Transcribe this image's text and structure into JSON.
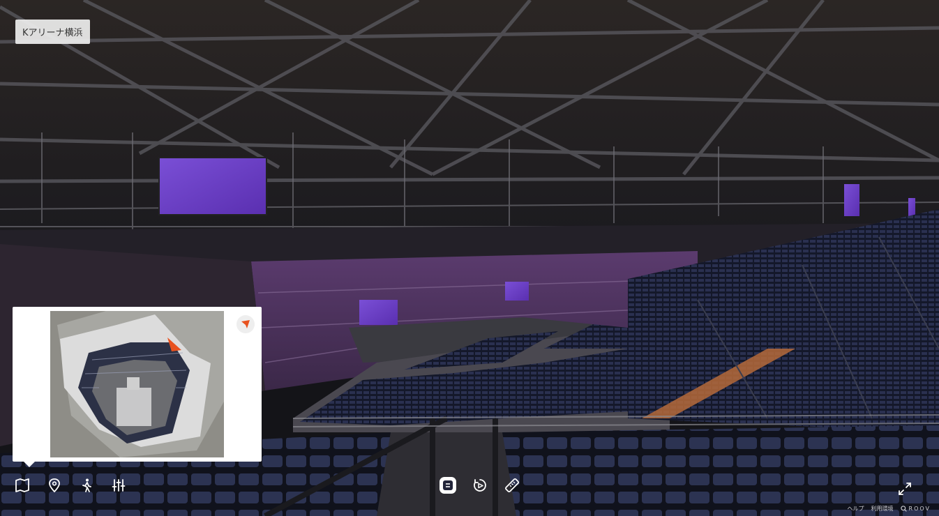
{
  "venue": {
    "name": "Kアリーナ横浜"
  },
  "toolbar": {
    "left": [
      {
        "id": "map",
        "icon": "map-icon"
      },
      {
        "id": "spot",
        "icon": "location-pin-icon"
      },
      {
        "id": "walk",
        "icon": "walking-person-icon"
      },
      {
        "id": "settings",
        "icon": "sliders-icon"
      }
    ],
    "center": [
      {
        "id": "info",
        "icon": "info-panel-icon"
      },
      {
        "id": "autoplay",
        "icon": "rotate-play-icon"
      },
      {
        "id": "measure",
        "icon": "ruler-icon"
      }
    ]
  },
  "footer": {
    "help": "ヘルプ",
    "environment": "利用環境",
    "brand": "ROOV"
  },
  "colors": {
    "accent_marker": "#e8521f",
    "screen_purple": "#6a3fc4",
    "seat_blue": "#1e2236",
    "panel_bg": "#ffffff"
  }
}
